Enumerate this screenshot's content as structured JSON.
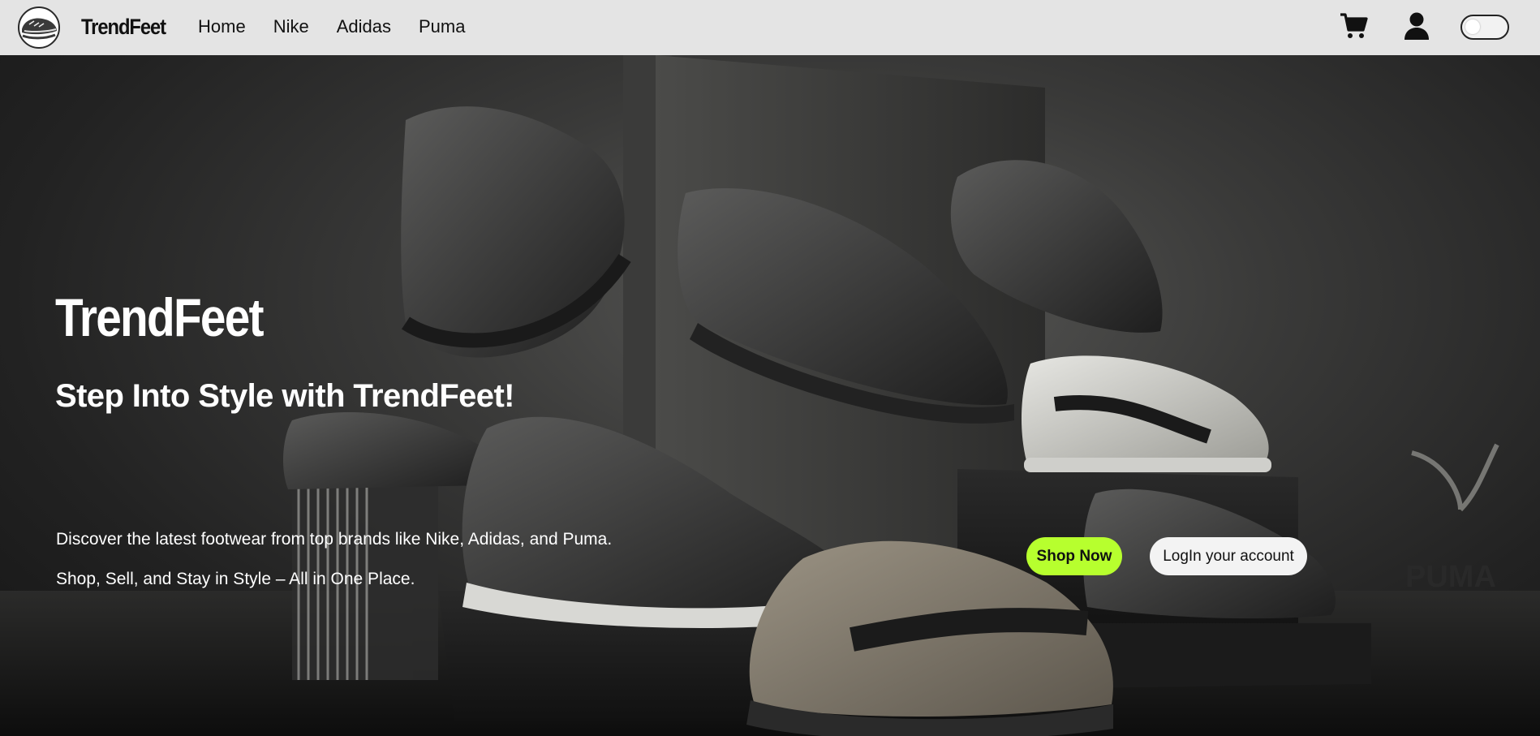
{
  "header": {
    "brand": "TrendFeet",
    "nav": [
      {
        "label": "Home"
      },
      {
        "label": "Nike"
      },
      {
        "label": "Adidas"
      },
      {
        "label": "Puma"
      }
    ],
    "icons": {
      "logo": "sneaker-logo-icon",
      "cart": "shopping-cart-icon",
      "user": "user-account-icon",
      "toggle": "theme-toggle"
    }
  },
  "hero": {
    "title": "TrendFeet",
    "subtitle": "Step Into Style with TrendFeet!",
    "description_line1": "Discover the latest footwear from top brands like Nike, Adidas, and Puma.",
    "description_line2": "Shop, Sell, and Stay in Style – All in One Place.",
    "primary_button": "Shop Now",
    "secondary_button": "LogIn your account",
    "background_logo_text": "PUMA"
  },
  "colors": {
    "nav_bg": "#e4e4e4",
    "accent": "#b7ff2e",
    "hero_text": "#ffffff"
  }
}
